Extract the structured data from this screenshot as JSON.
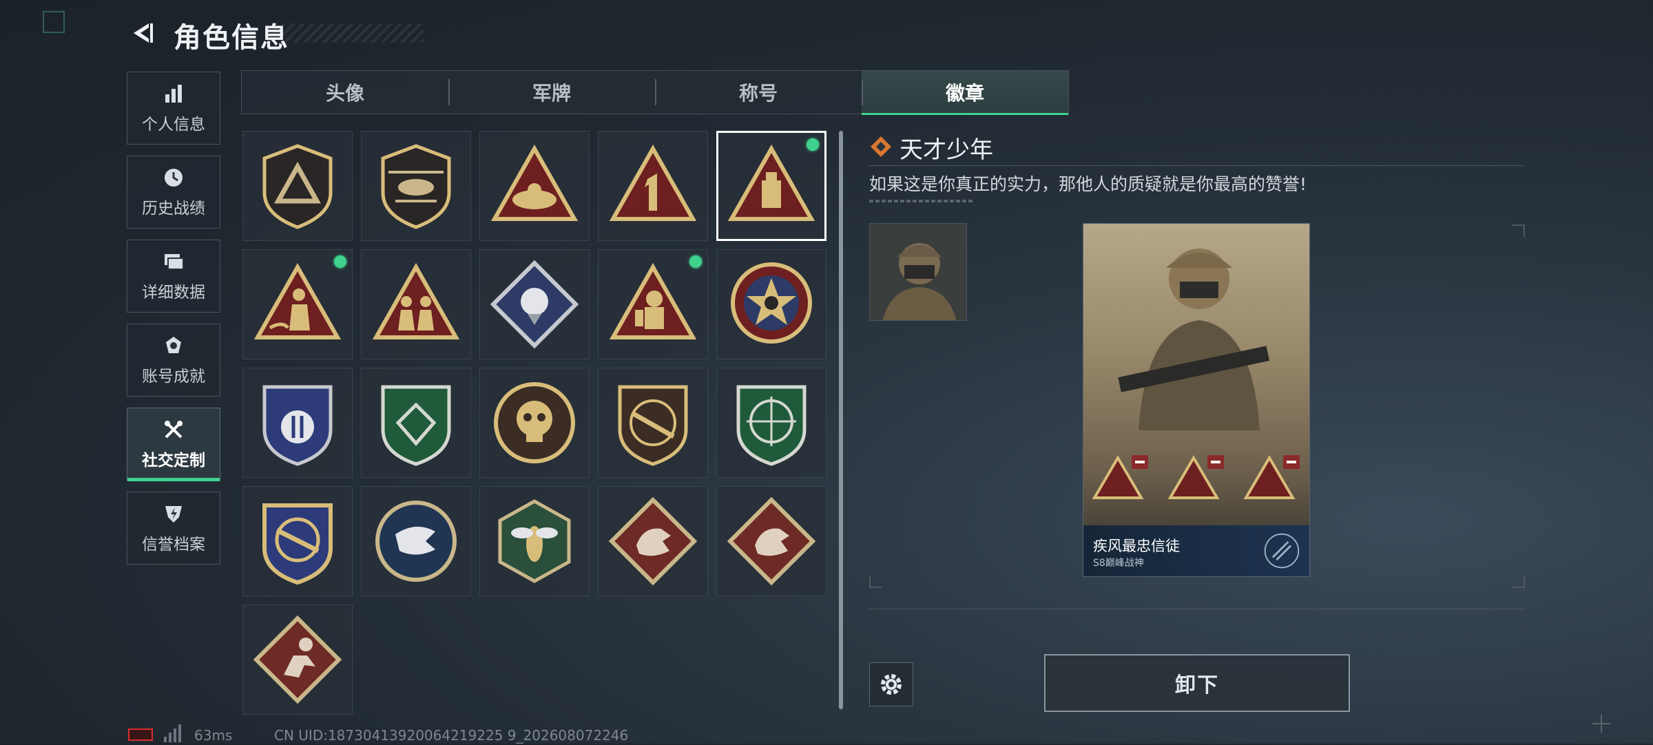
{
  "header": {
    "title": "角色信息"
  },
  "sidebar": {
    "items": [
      {
        "label": "个人信息",
        "icon": "bar-chart-icon",
        "active": false
      },
      {
        "label": "历史战绩",
        "icon": "clock-icon",
        "active": false
      },
      {
        "label": "详细数据",
        "icon": "cards-icon",
        "active": false
      },
      {
        "label": "账号成就",
        "icon": "achievement-icon",
        "active": false
      },
      {
        "label": "社交定制",
        "icon": "tools-icon",
        "active": true
      },
      {
        "label": "信誉档案",
        "icon": "shield-bolt-icon",
        "active": false
      }
    ]
  },
  "tabs": [
    {
      "label": "头像",
      "active": false
    },
    {
      "label": "军牌",
      "active": false
    },
    {
      "label": "称号",
      "active": false
    },
    {
      "label": "徽章",
      "active": true
    }
  ],
  "badges": [
    {
      "icon": "shield-triangle-badge",
      "new": false,
      "selected": false
    },
    {
      "icon": "helicopter-badge",
      "new": false,
      "selected": false
    },
    {
      "icon": "nest-triangle-badge",
      "new": false,
      "selected": false
    },
    {
      "icon": "number-one-triangle-badge",
      "new": false,
      "selected": false
    },
    {
      "icon": "usb-triangle-badge",
      "new": true,
      "selected": true
    },
    {
      "icon": "soldier-triangle-badge",
      "new": true,
      "selected": false
    },
    {
      "icon": "squad-triangle-badge",
      "new": false,
      "selected": false
    },
    {
      "icon": "rose-diamond-badge",
      "new": false,
      "selected": false
    },
    {
      "icon": "astronaut-triangle-badge",
      "new": true,
      "selected": false
    },
    {
      "icon": "star-skull-round-badge",
      "new": false,
      "selected": false
    },
    {
      "icon": "blue-wing-shield-badge",
      "new": false,
      "selected": false
    },
    {
      "icon": "green-gem-shield-badge",
      "new": false,
      "selected": false
    },
    {
      "icon": "skull-round-badge",
      "new": false,
      "selected": false
    },
    {
      "icon": "rifle-shield-badge",
      "new": false,
      "selected": false
    },
    {
      "icon": "green-crosshair-shield-badge",
      "new": false,
      "selected": false
    },
    {
      "icon": "gold-crosshair-shield-badge",
      "new": false,
      "selected": false
    },
    {
      "icon": "eagle-round-badge",
      "new": false,
      "selected": false
    },
    {
      "icon": "wasp-hexagon-badge",
      "new": false,
      "selected": false
    },
    {
      "icon": "dragon-diamond-badge",
      "new": false,
      "selected": false
    },
    {
      "icon": "dragon-diamond-badge",
      "new": false,
      "selected": false
    },
    {
      "icon": "runner-diamond-badge",
      "new": false,
      "selected": false
    }
  ],
  "detail": {
    "badge_name": "天才少年",
    "badge_description": "如果这是你真正的实力，那他人的质疑就是你最高的赞誉!",
    "card_name": "疾风最忠信徒",
    "card_sub": "S8巅峰战神",
    "unequip_label": "卸下"
  },
  "footer": {
    "ping": "63ms",
    "uid": "CN UID:18730413920064219225 9_202608072246"
  },
  "colors": {
    "accent_green": "#3fd28f",
    "badge_gold": "#d8bd7a",
    "badge_red": "#6e1f1f",
    "new_dot": "#3fd28f"
  }
}
